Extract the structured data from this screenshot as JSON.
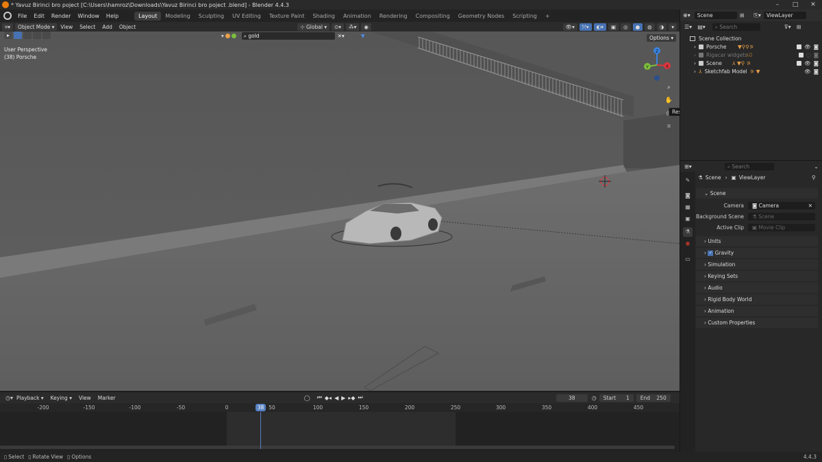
{
  "window": {
    "title": "* Yavuz Birinci bro poject [C:\\Users\\hamroz\\Downloads\\Yavuz Birinci bro poject .blend] - Blender 4.4.3",
    "controls": [
      "–",
      "□",
      "✕"
    ]
  },
  "menubar": {
    "menus": [
      "File",
      "Edit",
      "Render",
      "Window",
      "Help"
    ],
    "workspaces": [
      "Layout",
      "Modeling",
      "Sculpting",
      "UV Editing",
      "Texture Paint",
      "Shading",
      "Animation",
      "Rendering",
      "Compositing",
      "Geometry Nodes",
      "Scripting"
    ],
    "active_workspace": "Layout",
    "add_tab": "+",
    "scene": "Scene",
    "view_layer": "ViewLayer"
  },
  "viewport_header": {
    "mode": "Object Mode",
    "menus": [
      "View",
      "Select",
      "Add",
      "Object"
    ],
    "orientation": "Global",
    "search_value": "gold",
    "options": "Options"
  },
  "viewport": {
    "perspective": "User Perspective",
    "active_object": "(38) Porsche",
    "tooltip": "Restore Up",
    "gizmo_axes": [
      "Z",
      "X",
      "Y"
    ]
  },
  "outliner": {
    "search_placeholder": "Search",
    "root": "Scene Collection",
    "items": [
      {
        "name": "Porsche",
        "dim": false
      },
      {
        "name": "Rigacar widgets",
        "dim": true
      },
      {
        "name": "Scene",
        "dim": false
      },
      {
        "name": "Sketchfab Model",
        "dim": false
      }
    ],
    "item_suffix": "0"
  },
  "properties": {
    "search_placeholder": "Search",
    "breadcrumb": [
      "Scene",
      "ViewLayer"
    ],
    "panel_title": "Scene",
    "camera_label": "Camera",
    "camera_value": "Camera",
    "background_label": "Background Scene",
    "background_placeholder": "Scene",
    "clip_label": "Active Clip",
    "clip_placeholder": "Movie Clip",
    "sections": [
      "Units",
      "Gravity",
      "Simulation",
      "Keying Sets",
      "Audio",
      "Rigid Body World",
      "Animation",
      "Custom Properties"
    ]
  },
  "timeline": {
    "menus": [
      "Playback",
      "Keying",
      "View",
      "Marker"
    ],
    "current_frame": "38",
    "start_label": "Start",
    "start": "1",
    "end_label": "End",
    "end": "250",
    "ticks": [
      "-200",
      "-150",
      "-100",
      "-50",
      "0",
      "50",
      "100",
      "150",
      "200",
      "250",
      "300",
      "350",
      "400",
      "450"
    ]
  },
  "statusbar": {
    "items": [
      "Select",
      "Rotate View",
      "Options"
    ],
    "version": "4.4.3"
  },
  "colors": {
    "accent": "#4772b3",
    "playhead": "#5680c2",
    "outliner_orange": "#e8a04a",
    "axis_x": "#e0353f",
    "axis_y": "#7bbf3a",
    "axis_z": "#3a84e0"
  }
}
